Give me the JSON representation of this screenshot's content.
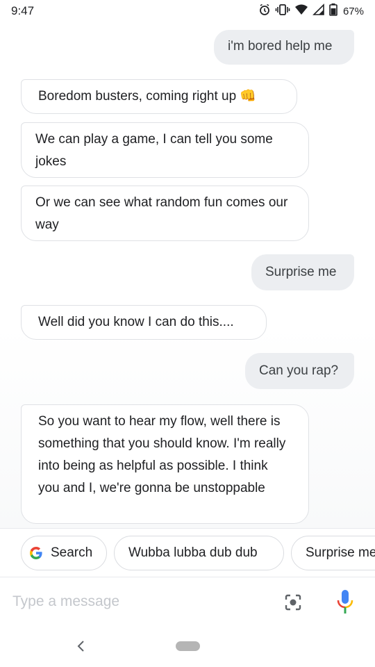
{
  "status_bar": {
    "time": "9:47",
    "battery_percent": "67%",
    "icons": [
      "alarm-icon",
      "vibrate-icon",
      "wifi-icon",
      "cellular-icon",
      "battery-icon"
    ]
  },
  "messages": [
    {
      "role": "user",
      "text": "i'm bored help me"
    },
    {
      "role": "assistant",
      "text": "Boredom busters, coming right up 👊"
    },
    {
      "role": "assistant",
      "text": "We can play a game, I can tell you some jokes"
    },
    {
      "role": "assistant",
      "text": "Or we can see what random fun comes our way"
    },
    {
      "role": "user",
      "text": "Surprise me"
    },
    {
      "role": "assistant",
      "text": "Well did you know I can do this...."
    },
    {
      "role": "user",
      "text": "Can you rap?"
    },
    {
      "role": "assistant",
      "text": "So you want to hear my flow, well there is something that you should know. I'm really into being as helpful as possible. I think you and I, we're gonna be unstoppable"
    }
  ],
  "suggestions": {
    "search_label": "Search",
    "chip_1": "Wubba lubba dub dub",
    "chip_2": "Surprise me"
  },
  "composer": {
    "placeholder": "Type a message",
    "value": ""
  },
  "colors": {
    "google_blue": "#4285f4",
    "google_red": "#ea4335",
    "google_yellow": "#fbbc05",
    "google_green": "#34a853",
    "user_bubble": "#eceef1"
  }
}
